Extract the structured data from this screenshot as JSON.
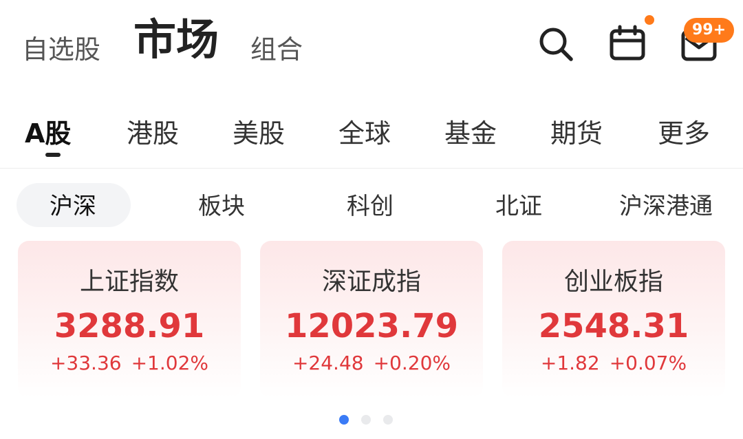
{
  "top_nav": {
    "items": [
      "自选股",
      "市场",
      "组合"
    ],
    "active": "市场"
  },
  "header_icons": [
    "search-icon",
    "calendar-icon",
    "mail-icon"
  ],
  "notification_badge": "99+",
  "market_tabs": [
    "A股",
    "港股",
    "美股",
    "全球",
    "基金",
    "期货",
    "更多"
  ],
  "sub_tabs": [
    "沪深",
    "板块",
    "科创",
    "北证",
    "沪深港通"
  ],
  "index_cards": [
    {
      "name": "上证指数",
      "value": "3288.91",
      "change": "+33.36",
      "change_pct": "+1.02%"
    },
    {
      "name": "深证成指",
      "value": "12023.79",
      "change": "+24.48",
      "change_pct": "+0.20%"
    },
    {
      "name": "创业板指",
      "value": "2548.31",
      "change": "+1.82",
      "change_pct": "+0.07%"
    }
  ],
  "pagination": {
    "total": 3,
    "current": 1
  },
  "colors": {
    "up": "#e0383b",
    "accent": "#ff7a1a",
    "pagination_active": "#3a7bf6"
  }
}
